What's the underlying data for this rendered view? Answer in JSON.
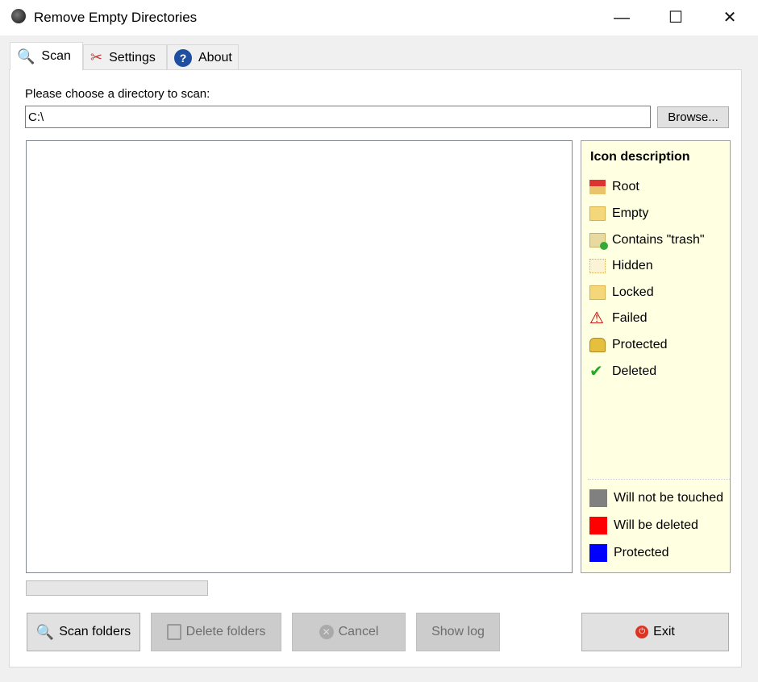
{
  "window": {
    "title": "Remove Empty Directories",
    "minimize": "—",
    "maximize": "☐",
    "close": "✕"
  },
  "tabs": [
    {
      "label": "Scan",
      "icon": "magnifier-icon",
      "active": true
    },
    {
      "label": "Settings",
      "icon": "tools-icon"
    },
    {
      "label": "About",
      "icon": "help-icon"
    }
  ],
  "scan": {
    "dir_label": "Please choose a directory to scan:",
    "dir_value": "C:\\",
    "browse": "Browse..."
  },
  "legend": {
    "title": "Icon description",
    "icons": [
      {
        "label": "Root",
        "icon": "house-icon"
      },
      {
        "label": "Empty",
        "icon": "folder-icon"
      },
      {
        "label": "Contains \"trash\"",
        "icon": "folder-trash-icon"
      },
      {
        "label": "Hidden",
        "icon": "hidden-folder-icon"
      },
      {
        "label": "Locked",
        "icon": "locked-folder-icon"
      },
      {
        "label": "Failed",
        "icon": "warning-icon"
      },
      {
        "label": "Protected",
        "icon": "padlock-icon"
      },
      {
        "label": "Deleted",
        "icon": "checkmark-icon"
      }
    ],
    "colors": [
      {
        "label": "Will not be touched",
        "color": "#808080"
      },
      {
        "label": "Will be deleted",
        "color": "#ff0000"
      },
      {
        "label": "Protected",
        "color": "#0000ff"
      }
    ]
  },
  "progress": 0,
  "buttons": {
    "scan": "Scan folders",
    "delete": "Delete folders",
    "cancel": "Cancel",
    "show_log": "Show log",
    "exit": "Exit"
  }
}
